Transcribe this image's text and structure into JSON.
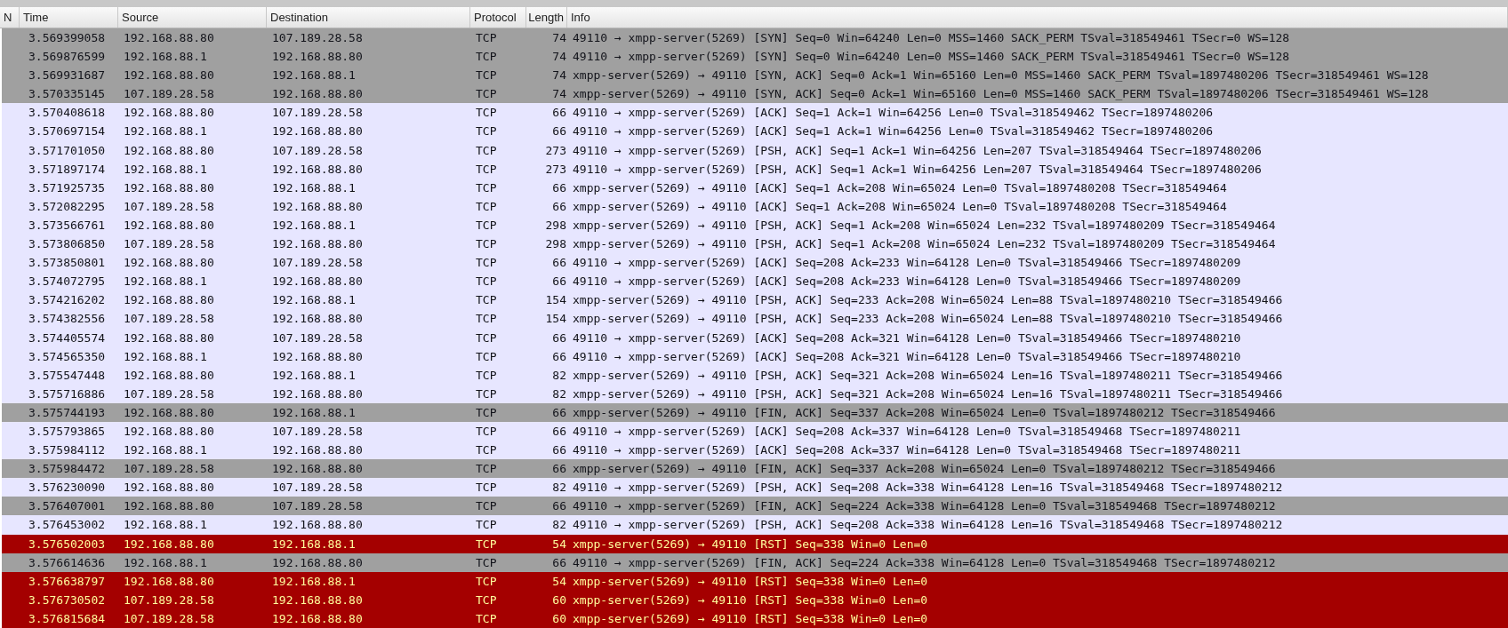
{
  "table": {
    "columns": [
      {
        "label": "N"
      },
      {
        "label": "Time"
      },
      {
        "label": "Source"
      },
      {
        "label": "Destination"
      },
      {
        "label": "Protocol"
      },
      {
        "label": "Length"
      },
      {
        "label": "Info"
      }
    ],
    "rows": [
      {
        "color": "#a0a0a0",
        "cells": [
          "",
          "3.569399058",
          "192.168.88.80",
          "107.189.28.58",
          "TCP",
          "74",
          "49110 → xmpp-server(5269) [SYN] Seq=0 Win=64240 Len=0 MSS=1460 SACK_PERM TSval=318549461 TSecr=0 WS=128"
        ]
      },
      {
        "color": "#a0a0a0",
        "cells": [
          "",
          "3.569876599",
          "192.168.88.1",
          "192.168.88.80",
          "TCP",
          "74",
          "49110 → xmpp-server(5269) [SYN] Seq=0 Win=64240 Len=0 MSS=1460 SACK_PERM TSval=318549461 TSecr=0 WS=128"
        ]
      },
      {
        "color": "#a0a0a0",
        "cells": [
          "",
          "3.569931687",
          "192.168.88.80",
          "192.168.88.1",
          "TCP",
          "74",
          "xmpp-server(5269) → 49110 [SYN, ACK] Seq=0 Ack=1 Win=65160 Len=0 MSS=1460 SACK_PERM TSval=1897480206 TSecr=318549461 WS=128"
        ]
      },
      {
        "color": "#a0a0a0",
        "cells": [
          "",
          "3.570335145",
          "107.189.28.58",
          "192.168.88.80",
          "TCP",
          "74",
          "xmpp-server(5269) → 49110 [SYN, ACK] Seq=0 Ack=1 Win=65160 Len=0 MSS=1460 SACK_PERM TSval=1897480206 TSecr=318549461 WS=128"
        ]
      },
      {
        "color": "#e7e6ff",
        "cells": [
          "",
          "3.570408618",
          "192.168.88.80",
          "107.189.28.58",
          "TCP",
          "66",
          "49110 → xmpp-server(5269) [ACK] Seq=1 Ack=1 Win=64256 Len=0 TSval=318549462 TSecr=1897480206"
        ]
      },
      {
        "color": "#e7e6ff",
        "cells": [
          "",
          "3.570697154",
          "192.168.88.1",
          "192.168.88.80",
          "TCP",
          "66",
          "49110 → xmpp-server(5269) [ACK] Seq=1 Ack=1 Win=64256 Len=0 TSval=318549462 TSecr=1897480206"
        ]
      },
      {
        "color": "#e7e6ff",
        "cells": [
          "",
          "3.571701050",
          "192.168.88.80",
          "107.189.28.58",
          "TCP",
          "273",
          "49110 → xmpp-server(5269) [PSH, ACK] Seq=1 Ack=1 Win=64256 Len=207 TSval=318549464 TSecr=1897480206"
        ]
      },
      {
        "color": "#e7e6ff",
        "cells": [
          "",
          "3.571897174",
          "192.168.88.1",
          "192.168.88.80",
          "TCP",
          "273",
          "49110 → xmpp-server(5269) [PSH, ACK] Seq=1 Ack=1 Win=64256 Len=207 TSval=318549464 TSecr=1897480206"
        ]
      },
      {
        "color": "#e7e6ff",
        "cells": [
          "",
          "3.571925735",
          "192.168.88.80",
          "192.168.88.1",
          "TCP",
          "66",
          "xmpp-server(5269) → 49110 [ACK] Seq=1 Ack=208 Win=65024 Len=0 TSval=1897480208 TSecr=318549464"
        ]
      },
      {
        "color": "#e7e6ff",
        "cells": [
          "",
          "3.572082295",
          "107.189.28.58",
          "192.168.88.80",
          "TCP",
          "66",
          "xmpp-server(5269) → 49110 [ACK] Seq=1 Ack=208 Win=65024 Len=0 TSval=1897480208 TSecr=318549464"
        ]
      },
      {
        "color": "#e7e6ff",
        "cells": [
          "",
          "3.573566761",
          "192.168.88.80",
          "192.168.88.1",
          "TCP",
          "298",
          "xmpp-server(5269) → 49110 [PSH, ACK] Seq=1 Ack=208 Win=65024 Len=232 TSval=1897480209 TSecr=318549464"
        ]
      },
      {
        "color": "#e7e6ff",
        "cells": [
          "",
          "3.573806850",
          "107.189.28.58",
          "192.168.88.80",
          "TCP",
          "298",
          "xmpp-server(5269) → 49110 [PSH, ACK] Seq=1 Ack=208 Win=65024 Len=232 TSval=1897480209 TSecr=318549464"
        ]
      },
      {
        "color": "#e7e6ff",
        "cells": [
          "",
          "3.573850801",
          "192.168.88.80",
          "107.189.28.58",
          "TCP",
          "66",
          "49110 → xmpp-server(5269) [ACK] Seq=208 Ack=233 Win=64128 Len=0 TSval=318549466 TSecr=1897480209"
        ]
      },
      {
        "color": "#e7e6ff",
        "cells": [
          "",
          "3.574072795",
          "192.168.88.1",
          "192.168.88.80",
          "TCP",
          "66",
          "49110 → xmpp-server(5269) [ACK] Seq=208 Ack=233 Win=64128 Len=0 TSval=318549466 TSecr=1897480209"
        ]
      },
      {
        "color": "#e7e6ff",
        "cells": [
          "",
          "3.574216202",
          "192.168.88.80",
          "192.168.88.1",
          "TCP",
          "154",
          "xmpp-server(5269) → 49110 [PSH, ACK] Seq=233 Ack=208 Win=65024 Len=88 TSval=1897480210 TSecr=318549466"
        ]
      },
      {
        "color": "#e7e6ff",
        "cells": [
          "",
          "3.574382556",
          "107.189.28.58",
          "192.168.88.80",
          "TCP",
          "154",
          "xmpp-server(5269) → 49110 [PSH, ACK] Seq=233 Ack=208 Win=65024 Len=88 TSval=1897480210 TSecr=318549466"
        ]
      },
      {
        "color": "#e7e6ff",
        "cells": [
          "",
          "3.574405574",
          "192.168.88.80",
          "107.189.28.58",
          "TCP",
          "66",
          "49110 → xmpp-server(5269) [ACK] Seq=208 Ack=321 Win=64128 Len=0 TSval=318549466 TSecr=1897480210"
        ]
      },
      {
        "color": "#e7e6ff",
        "cells": [
          "",
          "3.574565350",
          "192.168.88.1",
          "192.168.88.80",
          "TCP",
          "66",
          "49110 → xmpp-server(5269) [ACK] Seq=208 Ack=321 Win=64128 Len=0 TSval=318549466 TSecr=1897480210"
        ]
      },
      {
        "color": "#e7e6ff",
        "cells": [
          "",
          "3.575547448",
          "192.168.88.80",
          "192.168.88.1",
          "TCP",
          "82",
          "xmpp-server(5269) → 49110 [PSH, ACK] Seq=321 Ack=208 Win=65024 Len=16 TSval=1897480211 TSecr=318549466"
        ]
      },
      {
        "color": "#e7e6ff",
        "cells": [
          "",
          "3.575716886",
          "107.189.28.58",
          "192.168.88.80",
          "TCP",
          "82",
          "xmpp-server(5269) → 49110 [PSH, ACK] Seq=321 Ack=208 Win=65024 Len=16 TSval=1897480211 TSecr=318549466"
        ]
      },
      {
        "color": "#a0a0a0",
        "cells": [
          "",
          "3.575744193",
          "192.168.88.80",
          "192.168.88.1",
          "TCP",
          "66",
          "xmpp-server(5269) → 49110 [FIN, ACK] Seq=337 Ack=208 Win=65024 Len=0 TSval=1897480212 TSecr=318549466"
        ]
      },
      {
        "color": "#e7e6ff",
        "cells": [
          "",
          "3.575793865",
          "192.168.88.80",
          "107.189.28.58",
          "TCP",
          "66",
          "49110 → xmpp-server(5269) [ACK] Seq=208 Ack=337 Win=64128 Len=0 TSval=318549468 TSecr=1897480211"
        ]
      },
      {
        "color": "#e7e6ff",
        "cells": [
          "",
          "3.575984112",
          "192.168.88.1",
          "192.168.88.80",
          "TCP",
          "66",
          "49110 → xmpp-server(5269) [ACK] Seq=208 Ack=337 Win=64128 Len=0 TSval=318549468 TSecr=1897480211"
        ]
      },
      {
        "color": "#a0a0a0",
        "cells": [
          "",
          "3.575984472",
          "107.189.28.58",
          "192.168.88.80",
          "TCP",
          "66",
          "xmpp-server(5269) → 49110 [FIN, ACK] Seq=337 Ack=208 Win=65024 Len=0 TSval=1897480212 TSecr=318549466"
        ]
      },
      {
        "color": "#e7e6ff",
        "cells": [
          "",
          "3.576230090",
          "192.168.88.80",
          "107.189.28.58",
          "TCP",
          "82",
          "49110 → xmpp-server(5269) [PSH, ACK] Seq=208 Ack=338 Win=64128 Len=16 TSval=318549468 TSecr=1897480212"
        ]
      },
      {
        "color": "#a0a0a0",
        "cells": [
          "",
          "3.576407001",
          "192.168.88.80",
          "107.189.28.58",
          "TCP",
          "66",
          "49110 → xmpp-server(5269) [FIN, ACK] Seq=224 Ack=338 Win=64128 Len=0 TSval=318549468 TSecr=1897480212"
        ]
      },
      {
        "color": "#e7e6ff",
        "cells": [
          "",
          "3.576453002",
          "192.168.88.1",
          "192.168.88.80",
          "TCP",
          "82",
          "49110 → xmpp-server(5269) [PSH, ACK] Seq=208 Ack=338 Win=64128 Len=16 TSval=318549468 TSecr=1897480212"
        ]
      },
      {
        "color": "#a40000",
        "cells": [
          "",
          "3.576502003",
          "192.168.88.80",
          "192.168.88.1",
          "TCP",
          "54",
          "xmpp-server(5269) → 49110 [RST] Seq=338 Win=0 Len=0"
        ]
      },
      {
        "color": "#a0a0a0",
        "cells": [
          "",
          "3.576614636",
          "192.168.88.1",
          "192.168.88.80",
          "TCP",
          "66",
          "49110 → xmpp-server(5269) [FIN, ACK] Seq=224 Ack=338 Win=64128 Len=0 TSval=318549468 TSecr=1897480212"
        ]
      },
      {
        "color": "#a40000",
        "cells": [
          "",
          "3.576638797",
          "192.168.88.80",
          "192.168.88.1",
          "TCP",
          "54",
          "xmpp-server(5269) → 49110 [RST] Seq=338 Win=0 Len=0"
        ]
      },
      {
        "color": "#a40000",
        "cells": [
          "",
          "3.576730502",
          "107.189.28.58",
          "192.168.88.80",
          "TCP",
          "60",
          "xmpp-server(5269) → 49110 [RST] Seq=338 Win=0 Len=0"
        ]
      },
      {
        "color": "#a40000",
        "cells": [
          "",
          "3.576815684",
          "107.189.28.58",
          "192.168.88.80",
          "TCP",
          "60",
          "xmpp-server(5269) → 49110 [RST] Seq=338 Win=0 Len=0"
        ]
      }
    ]
  }
}
